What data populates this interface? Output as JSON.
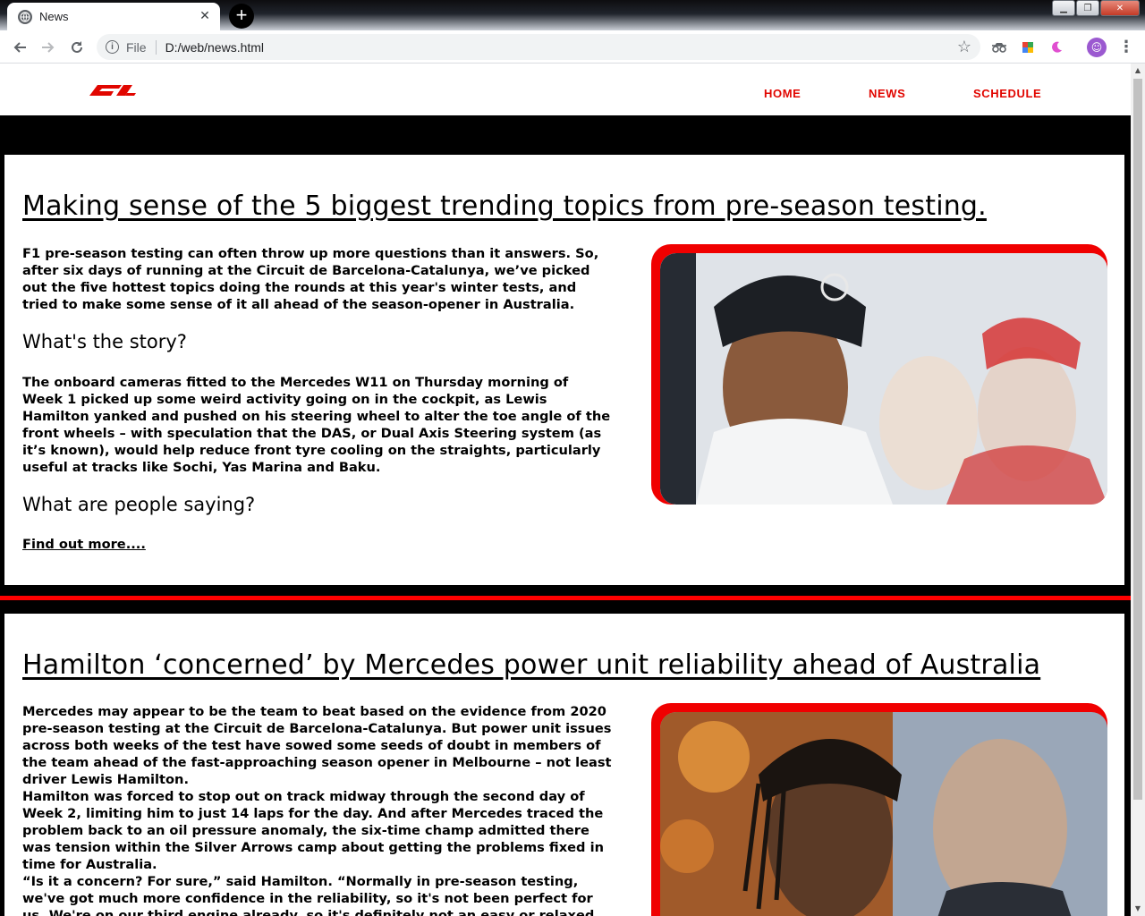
{
  "browser": {
    "tab_title": "News",
    "tab_close": "✕",
    "new_tab": "+",
    "url_scheme": "File",
    "url": "D:/web/news.html"
  },
  "site": {
    "nav": [
      "HOME",
      "NEWS",
      "SCHEDULE"
    ],
    "brand_color": "#e10600"
  },
  "articles": [
    {
      "title": "Making sense of the 5 biggest trending topics from pre-season testing.",
      "intro": "F1 pre-season testing can often throw up more questions than it answers. So, after six days of running at the Circuit de Barcelona-Catalunya, we’ve picked out the five hottest topics doing the rounds at this year's winter tests, and tried to make some sense of it all ahead of the season-opener in Australia.",
      "subhead1": "What's the story?",
      "story": "The onboard cameras fitted to the Mercedes W11 on Thursday morning of Week 1 picked up some weird activity going on in the cockpit, as Lewis Hamilton yanked and pushed on his steering wheel to alter the toe angle of the front wheels – with speculation that the DAS, or Dual Axis Steering system (as it’s known), would help reduce front tyre cooling on the straights, particularly useful at tracks like Sochi, Yas Marina and Baku.",
      "subhead2": "What are people saying?",
      "link": "Find out more...."
    },
    {
      "title": "Hamilton ‘concerned’ by Mercedes power unit reliability ahead of Australia",
      "p1": "Mercedes may appear to be the team to beat based on the evidence from 2020 pre-season testing at the Circuit de Barcelona-Catalunya. But power unit issues across both weeks of the test have sowed some seeds of doubt in members of the team ahead of the fast-approaching season opener in Melbourne – not least driver Lewis Hamilton.",
      "p2": "Hamilton was forced to stop out on track midway through the second day of Week 2, limiting him to just 14 laps for the day. And after Mercedes traced the problem back to an oil pressure anomaly, the six-time champ admitted there was tension within the Silver Arrows camp about getting the problems fixed in time for Australia.",
      "p3": "“Is it a concern? For sure,” said Hamilton. “Normally in pre-season testing, we've got much more confidence in the reliability, so it's not been perfect for us. We're on our third engine already, so it's definitely not an easy or relaxed scenario for"
    }
  ]
}
